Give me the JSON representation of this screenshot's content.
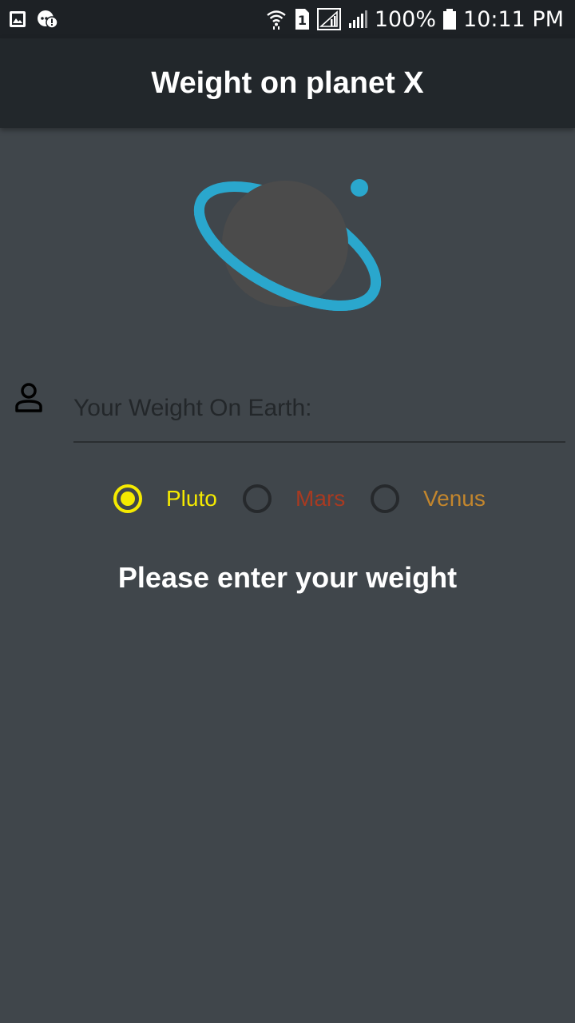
{
  "status_bar": {
    "left_icons": [
      "image-icon",
      "chat-alert-icon"
    ],
    "right_icons": [
      "wifi-icon",
      "sim-1-icon",
      "signal-icon",
      "signal-icon",
      "battery-icon"
    ],
    "battery": "100%",
    "time": "10:11 PM"
  },
  "app_bar": {
    "title": "Weight on planet X"
  },
  "logo": {
    "icon": "planet-icon",
    "ring_color": "#2aa7cd",
    "planet_color": "#4b4b4b"
  },
  "weight_field": {
    "icon": "person-icon",
    "placeholder": "Your Weight On Earth:",
    "value": ""
  },
  "planets": {
    "options": [
      {
        "label": "Pluto",
        "color": "#f5ea00",
        "selected": true
      },
      {
        "label": "Mars",
        "color": "#a83a21",
        "selected": false
      },
      {
        "label": "Venus",
        "color": "#c3862d",
        "selected": false
      }
    ]
  },
  "result": {
    "message": "Please enter your weight"
  },
  "colors": {
    "background": "#40464b",
    "app_bar": "#22272b",
    "status_bar": "#1d2125",
    "accent": "#f5ea00"
  }
}
